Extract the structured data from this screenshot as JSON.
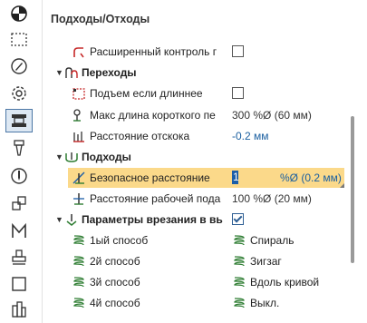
{
  "panel": {
    "title": "Подходы/Отходы"
  },
  "sidebar": {
    "items": [
      {
        "icon": "target-icon"
      },
      {
        "icon": "dashed-rectangle-icon"
      },
      {
        "icon": "compass-pen-icon"
      },
      {
        "icon": "gear-icon"
      },
      {
        "icon": "approach-retract-icon",
        "active": true
      },
      {
        "icon": "drill-bit-icon"
      },
      {
        "icon": "spindle-tool-icon"
      },
      {
        "icon": "layers-icon"
      },
      {
        "icon": "letter-m-icon"
      },
      {
        "icon": "stamp-icon"
      },
      {
        "icon": "square-icon"
      },
      {
        "icon": "building-icon"
      }
    ]
  },
  "rows": {
    "extended_control": {
      "label": "Расширенный контроль г",
      "checked": false
    },
    "transitions_group": {
      "label": "Переходы"
    },
    "lift_if_longer": {
      "label": "Подъем если длиннее",
      "checked": false
    },
    "max_short_len": {
      "label": "Макс длина короткого пе",
      "value": "300 %Ø (60 мм)"
    },
    "bounce_distance": {
      "label": "Расстояние отскока",
      "value": "-0.2 мм"
    },
    "approaches_group": {
      "label": "Подходы"
    },
    "safe_distance": {
      "label": "Безопасное расстояние",
      "input": "1",
      "value": "%Ø (0.2 мм)"
    },
    "work_feed_distance": {
      "label": "Расстояние рабочей пода",
      "value": "100 %Ø (20 мм)"
    },
    "plunge_params": {
      "label": "Параметры врезания в вь",
      "checked": true
    },
    "method1": {
      "label": "1ый способ",
      "value": "Спираль"
    },
    "method2": {
      "label": "2й способ",
      "value": "Зигзаг"
    },
    "method3": {
      "label": "3й способ",
      "value": "Вдоль кривой"
    },
    "method4": {
      "label": "4й способ",
      "value": "Выкл."
    }
  },
  "colors": {
    "selection": "#fbd98a",
    "accent": "#1a5fa0",
    "active_sidebar": "#dde8f3"
  }
}
